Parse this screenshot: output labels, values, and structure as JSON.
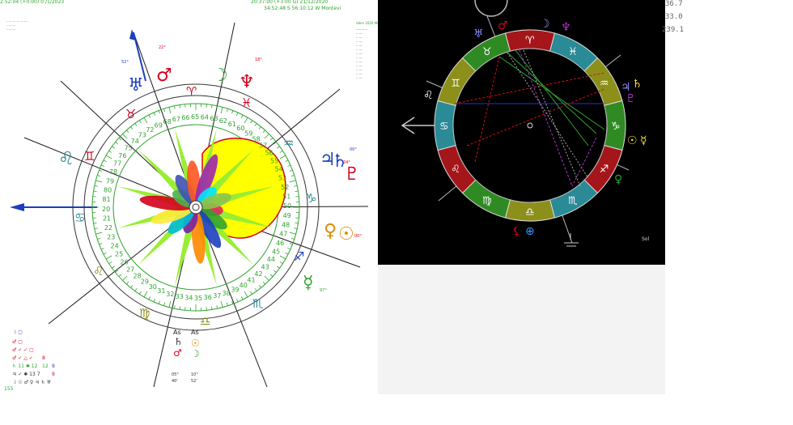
{
  "header": {
    "left_time": "2:52:04 (+0:00) 0:/1/2023",
    "center_time": "20:37:00 (+3:00 G) 21/12/2020",
    "center_place": "34:52:48 S  56:10:12 W  Montevi",
    "center_extra": "idem 2020 Mon"
  },
  "left_chart": {
    "inner_numbers_top": [
      "69",
      "68",
      "67",
      "66",
      "65",
      "64",
      "63",
      "62",
      "61",
      "60"
    ],
    "inner_numbers_right": [
      "59",
      "58",
      "57",
      "56",
      "55",
      "54",
      "53",
      "52",
      "51",
      "50"
    ],
    "inner_numbers_left": [
      "72",
      "73",
      "74",
      "75",
      "76",
      "77",
      "78",
      "79",
      "80",
      "81",
      "20",
      "21",
      "22",
      "23",
      "24",
      "25",
      "26",
      "27",
      "28",
      "29"
    ],
    "inner_numbers_bottom": [
      "30",
      "31",
      "32",
      "33",
      "34",
      "35",
      "36",
      "37",
      "38",
      "39",
      "40",
      "41",
      "42",
      "43",
      "44",
      "45",
      "46",
      "47",
      "48",
      "49"
    ],
    "labels": {
      "as1": "As",
      "as2": "As",
      "deg_a": "22°",
      "deg_b": "18°",
      "deg_c": "52°",
      "deg_d": "00°",
      "deg_e": "24°",
      "deg_f": "00°",
      "deg_g": "97°",
      "deg_h": "05°",
      "deg_i": "10°",
      "deg_j": "40'",
      "deg_k": "52'"
    },
    "aspect_table": {
      "row_labels": [
        "☽",
        "♂",
        "♂",
        "♂",
        "♄",
        "♄",
        "♃",
        "☽"
      ],
      "values": [
        "8",
        "12",
        "7",
        "9",
        "13",
        "7",
        "9",
        "155"
      ]
    },
    "colors": {
      "ring_green": "#2fa32f",
      "petal_yellow": "#ffff00",
      "spike_green": "#99ee33",
      "red": "#d4001c",
      "blue": "#1c3fbf"
    }
  },
  "right_chart": {
    "readouts": [
      "36.7",
      "33.0",
      "239.1"
    ],
    "footer": "Sol",
    "colors": {
      "seg_red": "#a4161a",
      "seg_teal": "#2a8a96",
      "seg_olive": "#8c8f1a",
      "seg_green": "#2f8a24"
    }
  },
  "icons": {
    "sun": "sun-icon",
    "moon": "moon-icon",
    "mars": "mars-icon",
    "venus": "venus-icon",
    "jupiter": "jupiter-icon",
    "saturn": "saturn-icon",
    "neptune": "neptune-icon",
    "uranus": "uranus-icon",
    "pluto": "pluto-icon"
  }
}
